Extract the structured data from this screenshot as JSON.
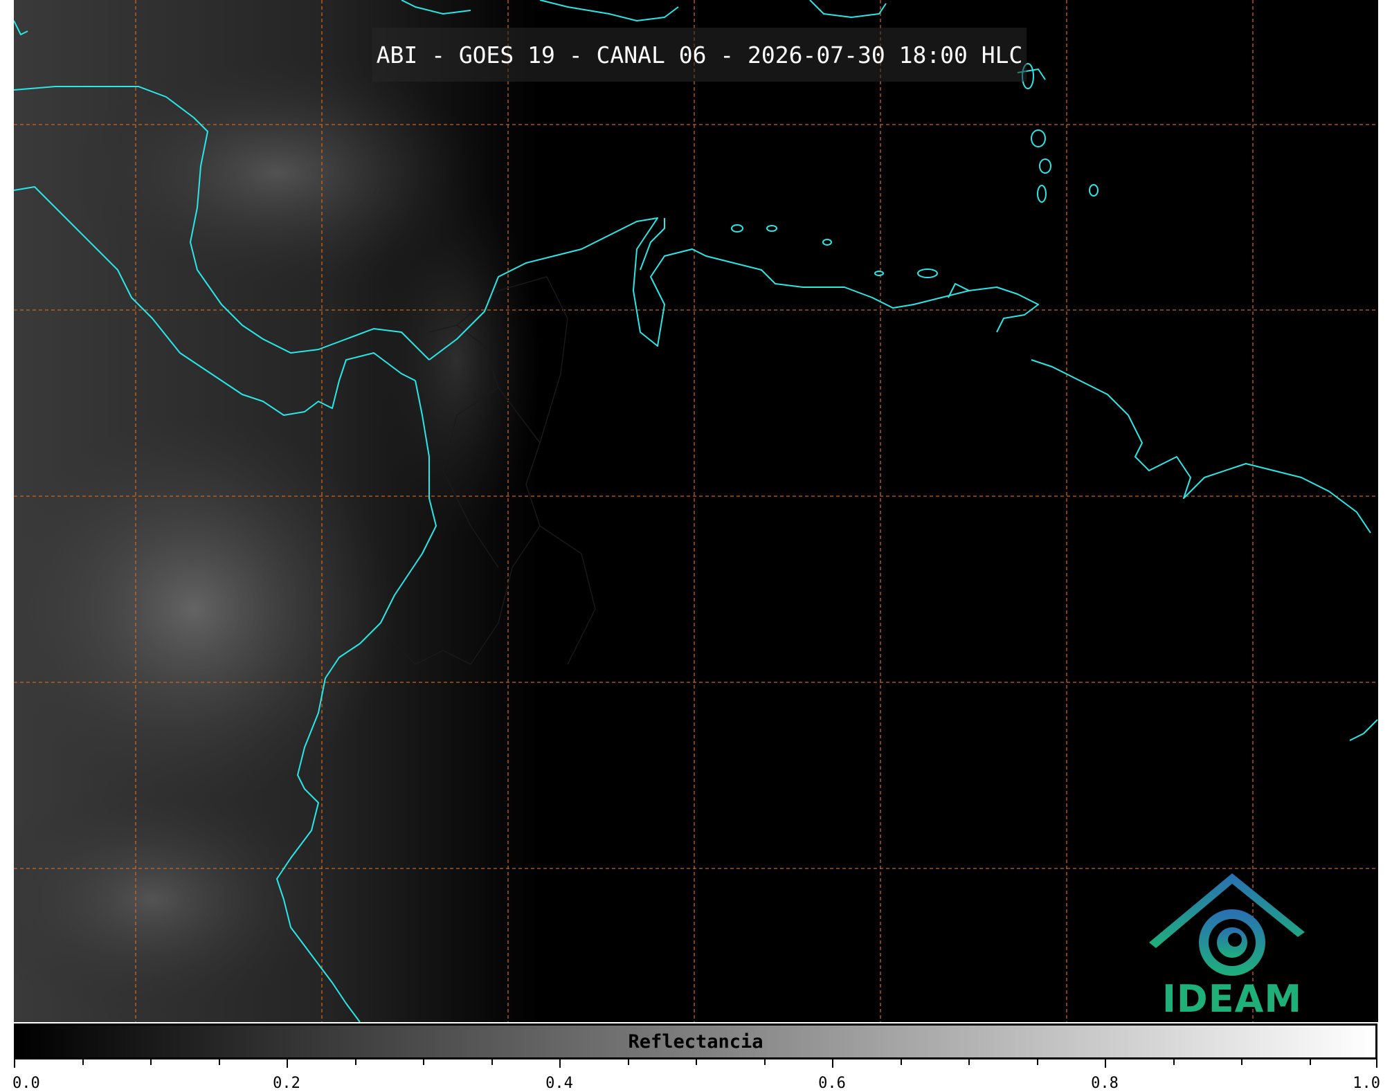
{
  "title": "ABI - GOES 19 - CANAL 06 - 2026-07-30 18:00 HLC",
  "colorbar": {
    "label": "Reflectancia",
    "min": 0.0,
    "max": 1.0,
    "major_ticks": [
      "0.0",
      "0.2",
      "0.4",
      "0.6",
      "0.8",
      "1.0"
    ],
    "minor_step": 0.05
  },
  "logo": {
    "text": "IDEAM",
    "icon": "ideam-logo-icon",
    "color_blue": "#2a6fb5",
    "color_green": "#1fb07a"
  },
  "colors": {
    "coastline": "#28e8e8",
    "gridlines": "#d2691e",
    "borders": "#1a1a1a",
    "background": "#000000"
  }
}
